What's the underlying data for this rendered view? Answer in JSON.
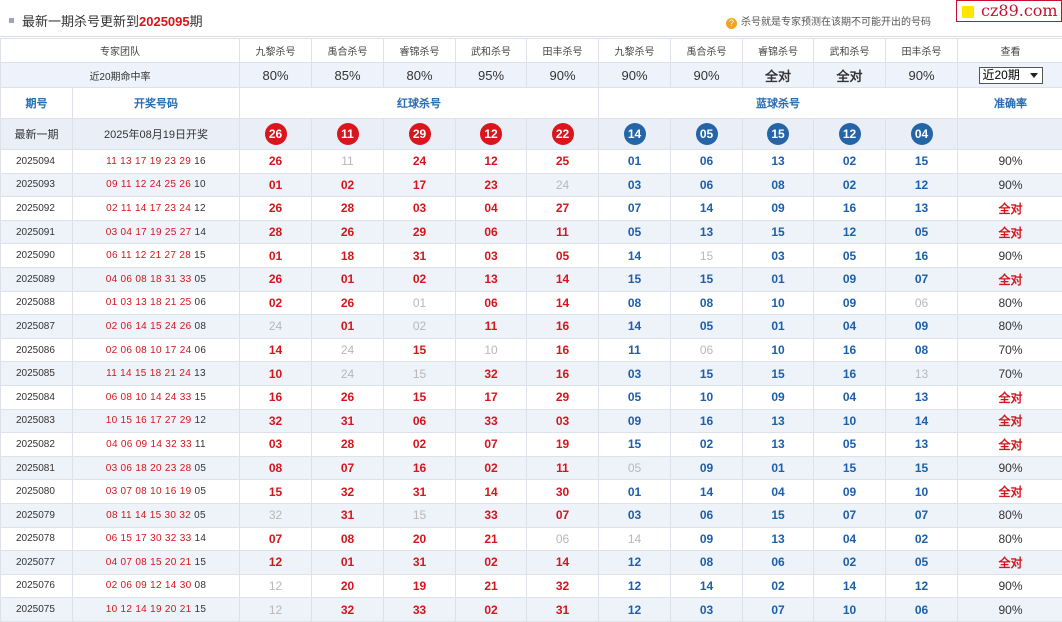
{
  "header": {
    "title_prefix": "最新一期杀号更新到",
    "issue": "2025095",
    "title_suffix": "期",
    "note": "杀号就是专家预测在该期不可能开出的号码",
    "note_icon": "?",
    "brand": "cz89.com"
  },
  "experts_row": {
    "label": "专家团队",
    "red": [
      "九黎杀号",
      "禹合杀号",
      "睿锦杀号",
      "武和杀号",
      "田丰杀号"
    ],
    "blue": [
      "九黎杀号",
      "禹合杀号",
      "睿锦杀号",
      "武和杀号",
      "田丰杀号"
    ],
    "view_label": "查看"
  },
  "hitrate_row": {
    "label": "近20期命中率",
    "red": [
      "80%",
      "85%",
      "80%",
      "95%",
      "90%"
    ],
    "blue": [
      "90%",
      "90%",
      "全对",
      "全对",
      "90%"
    ],
    "select_value": "近20期"
  },
  "columns": {
    "period": "期号",
    "draw": "开奖号码",
    "red_kill": "红球杀号",
    "blue_kill": "蓝球杀号",
    "accuracy": "准确率"
  },
  "latest": {
    "label": "最新一期",
    "date": "2025年08月19日开奖",
    "red": [
      "26",
      "11",
      "29",
      "12",
      "22"
    ],
    "blue": [
      "14",
      "05",
      "15",
      "12",
      "04"
    ]
  },
  "rows": [
    {
      "period": "2025094",
      "draw_red": "11 13 17 19 23 29",
      "draw_blue": "16",
      "red": [
        "26",
        "11",
        "24",
        "12",
        "25"
      ],
      "red_miss": [
        false,
        true,
        false,
        false,
        false
      ],
      "blue": [
        "01",
        "06",
        "13",
        "02",
        "15"
      ],
      "blue_miss": [
        false,
        false,
        false,
        false,
        false
      ],
      "acc": "90%"
    },
    {
      "period": "2025093",
      "draw_red": "09 11 12 24 25 26",
      "draw_blue": "10",
      "red": [
        "01",
        "02",
        "17",
        "23",
        "24"
      ],
      "red_miss": [
        false,
        false,
        false,
        false,
        true
      ],
      "blue": [
        "03",
        "06",
        "08",
        "02",
        "12"
      ],
      "blue_miss": [
        false,
        false,
        false,
        false,
        false
      ],
      "acc": "90%"
    },
    {
      "period": "2025092",
      "draw_red": "02 11 14 17 23 24",
      "draw_blue": "12",
      "red": [
        "26",
        "28",
        "03",
        "04",
        "27"
      ],
      "red_miss": [
        false,
        false,
        false,
        false,
        false
      ],
      "blue": [
        "07",
        "14",
        "09",
        "16",
        "13"
      ],
      "blue_miss": [
        false,
        false,
        false,
        false,
        false
      ],
      "acc": "全对"
    },
    {
      "period": "2025091",
      "draw_red": "03 04 17 19 25 27",
      "draw_blue": "14",
      "red": [
        "28",
        "26",
        "29",
        "06",
        "11"
      ],
      "red_miss": [
        false,
        false,
        false,
        false,
        false
      ],
      "blue": [
        "05",
        "13",
        "15",
        "12",
        "05"
      ],
      "blue_miss": [
        false,
        false,
        false,
        false,
        false
      ],
      "acc": "全对"
    },
    {
      "period": "2025090",
      "draw_red": "06 11 12 21 27 28",
      "draw_blue": "15",
      "red": [
        "01",
        "18",
        "31",
        "03",
        "05"
      ],
      "red_miss": [
        false,
        false,
        false,
        false,
        false
      ],
      "blue": [
        "14",
        "15",
        "03",
        "05",
        "16"
      ],
      "blue_miss": [
        false,
        true,
        false,
        false,
        false
      ],
      "acc": "90%"
    },
    {
      "period": "2025089",
      "draw_red": "04 06 08 18 31 33",
      "draw_blue": "05",
      "red": [
        "26",
        "01",
        "02",
        "13",
        "14"
      ],
      "red_miss": [
        false,
        false,
        false,
        false,
        false
      ],
      "blue": [
        "15",
        "15",
        "01",
        "09",
        "07"
      ],
      "blue_miss": [
        false,
        false,
        false,
        false,
        false
      ],
      "acc": "全对"
    },
    {
      "period": "2025088",
      "draw_red": "01 03 13 18 21 25",
      "draw_blue": "06",
      "red": [
        "02",
        "26",
        "01",
        "06",
        "14"
      ],
      "red_miss": [
        false,
        false,
        true,
        false,
        false
      ],
      "blue": [
        "08",
        "08",
        "10",
        "09",
        "06"
      ],
      "blue_miss": [
        false,
        false,
        false,
        false,
        true
      ],
      "acc": "80%"
    },
    {
      "period": "2025087",
      "draw_red": "02 06 14 15 24 26",
      "draw_blue": "08",
      "red": [
        "24",
        "01",
        "02",
        "11",
        "16"
      ],
      "red_miss": [
        true,
        false,
        true,
        false,
        false
      ],
      "blue": [
        "14",
        "05",
        "01",
        "04",
        "09"
      ],
      "blue_miss": [
        false,
        false,
        false,
        false,
        false
      ],
      "acc": "80%"
    },
    {
      "period": "2025086",
      "draw_red": "02 06 08 10 17 24",
      "draw_blue": "06",
      "red": [
        "14",
        "24",
        "15",
        "10",
        "16"
      ],
      "red_miss": [
        false,
        true,
        false,
        true,
        false
      ],
      "blue": [
        "11",
        "06",
        "10",
        "16",
        "08"
      ],
      "blue_miss": [
        false,
        true,
        false,
        false,
        false
      ],
      "acc": "70%"
    },
    {
      "period": "2025085",
      "draw_red": "11 14 15 18 21 24",
      "draw_blue": "13",
      "red": [
        "10",
        "24",
        "15",
        "32",
        "16"
      ],
      "red_miss": [
        false,
        true,
        true,
        false,
        false
      ],
      "blue": [
        "03",
        "15",
        "15",
        "16",
        "13"
      ],
      "blue_miss": [
        false,
        false,
        false,
        false,
        true
      ],
      "acc": "70%"
    },
    {
      "period": "2025084",
      "draw_red": "06 08 10 14 24 33",
      "draw_blue": "15",
      "red": [
        "16",
        "26",
        "15",
        "17",
        "29"
      ],
      "red_miss": [
        false,
        false,
        false,
        false,
        false
      ],
      "blue": [
        "05",
        "10",
        "09",
        "04",
        "13"
      ],
      "blue_miss": [
        false,
        false,
        false,
        false,
        false
      ],
      "acc": "全对"
    },
    {
      "period": "2025083",
      "draw_red": "10 15 16 17 27 29",
      "draw_blue": "12",
      "red": [
        "32",
        "31",
        "06",
        "33",
        "03"
      ],
      "red_miss": [
        false,
        false,
        false,
        false,
        false
      ],
      "blue": [
        "09",
        "16",
        "13",
        "10",
        "14"
      ],
      "blue_miss": [
        false,
        false,
        false,
        false,
        false
      ],
      "acc": "全对"
    },
    {
      "period": "2025082",
      "draw_red": "04 06 09 14 32 33",
      "draw_blue": "11",
      "red": [
        "03",
        "28",
        "02",
        "07",
        "19"
      ],
      "red_miss": [
        false,
        false,
        false,
        false,
        false
      ],
      "blue": [
        "15",
        "02",
        "13",
        "05",
        "13"
      ],
      "blue_miss": [
        false,
        false,
        false,
        false,
        false
      ],
      "acc": "全对"
    },
    {
      "period": "2025081",
      "draw_red": "03 06 18 20 23 28",
      "draw_blue": "05",
      "red": [
        "08",
        "07",
        "16",
        "02",
        "11"
      ],
      "red_miss": [
        false,
        false,
        false,
        false,
        false
      ],
      "blue": [
        "05",
        "09",
        "01",
        "15",
        "15"
      ],
      "blue_miss": [
        true,
        false,
        false,
        false,
        false
      ],
      "acc": "90%"
    },
    {
      "period": "2025080",
      "draw_red": "03 07 08 10 16 19",
      "draw_blue": "05",
      "red": [
        "15",
        "32",
        "31",
        "14",
        "30"
      ],
      "red_miss": [
        false,
        false,
        false,
        false,
        false
      ],
      "blue": [
        "01",
        "14",
        "04",
        "09",
        "10"
      ],
      "blue_miss": [
        false,
        false,
        false,
        false,
        false
      ],
      "acc": "全对"
    },
    {
      "period": "2025079",
      "draw_red": "08 11 14 15 30 32",
      "draw_blue": "05",
      "red": [
        "32",
        "31",
        "15",
        "33",
        "07"
      ],
      "red_miss": [
        true,
        false,
        true,
        false,
        false
      ],
      "blue": [
        "03",
        "06",
        "15",
        "07",
        "07"
      ],
      "blue_miss": [
        false,
        false,
        false,
        false,
        false
      ],
      "acc": "80%"
    },
    {
      "period": "2025078",
      "draw_red": "06 15 17 30 32 33",
      "draw_blue": "14",
      "red": [
        "07",
        "08",
        "20",
        "21",
        "06"
      ],
      "red_miss": [
        false,
        false,
        false,
        false,
        true
      ],
      "blue": [
        "14",
        "09",
        "13",
        "04",
        "02"
      ],
      "blue_miss": [
        true,
        false,
        false,
        false,
        false
      ],
      "acc": "80%"
    },
    {
      "period": "2025077",
      "draw_red": "04 07 08 15 20 21",
      "draw_blue": "15",
      "red": [
        "12",
        "01",
        "31",
        "02",
        "14"
      ],
      "red_miss": [
        false,
        false,
        false,
        false,
        false
      ],
      "blue": [
        "12",
        "08",
        "06",
        "02",
        "05"
      ],
      "blue_miss": [
        false,
        false,
        false,
        false,
        false
      ],
      "acc": "全对"
    },
    {
      "period": "2025076",
      "draw_red": "02 06 09 12 14 30",
      "draw_blue": "08",
      "red": [
        "12",
        "20",
        "19",
        "21",
        "32"
      ],
      "red_miss": [
        true,
        false,
        false,
        false,
        false
      ],
      "blue": [
        "12",
        "14",
        "02",
        "14",
        "12"
      ],
      "blue_miss": [
        false,
        false,
        false,
        false,
        false
      ],
      "acc": "90%"
    },
    {
      "period": "2025075",
      "draw_red": "10 12 14 19 20 21",
      "draw_blue": "15",
      "red": [
        "12",
        "32",
        "33",
        "02",
        "31"
      ],
      "red_miss": [
        true,
        false,
        false,
        false,
        false
      ],
      "blue": [
        "12",
        "03",
        "07",
        "10",
        "06"
      ],
      "blue_miss": [
        false,
        false,
        false,
        false,
        false
      ],
      "acc": "90%"
    }
  ]
}
